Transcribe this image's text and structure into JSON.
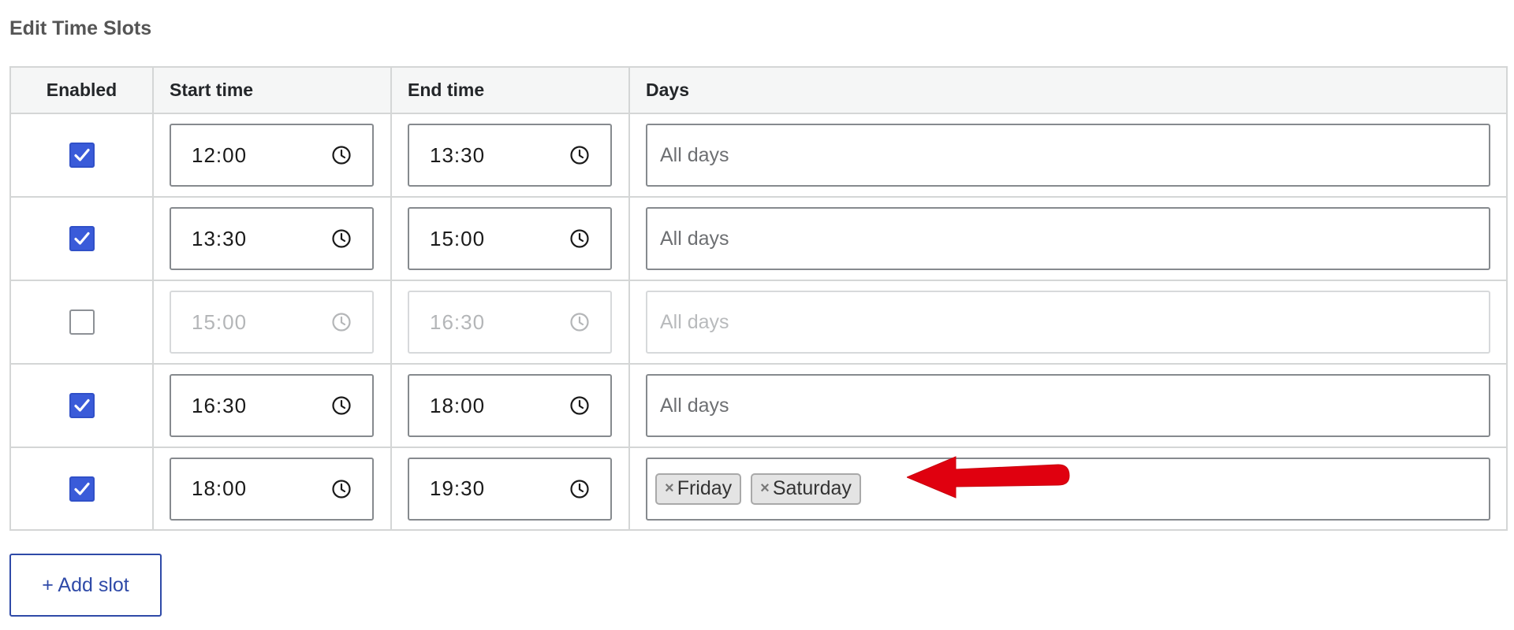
{
  "page": {
    "title": "Edit Time Slots"
  },
  "table": {
    "headers": {
      "enabled": "Enabled",
      "start_time": "Start time",
      "end_time": "End time",
      "days": "Days"
    },
    "rows": [
      {
        "enabled": true,
        "start": "12:00",
        "end": "13:30",
        "days_placeholder": "All days",
        "days_tags": []
      },
      {
        "enabled": true,
        "start": "13:30",
        "end": "15:00",
        "days_placeholder": "All days",
        "days_tags": []
      },
      {
        "enabled": false,
        "start": "15:00",
        "end": "16:30",
        "days_placeholder": "All days",
        "days_tags": []
      },
      {
        "enabled": true,
        "start": "16:30",
        "end": "18:00",
        "days_placeholder": "All days",
        "days_tags": []
      },
      {
        "enabled": true,
        "start": "18:00",
        "end": "19:30",
        "days_placeholder": "",
        "days_tags": [
          "Friday",
          "Saturday"
        ]
      }
    ]
  },
  "actions": {
    "add_slot_label": "+ Add slot"
  },
  "icons": {
    "checkbox": "checkmark-icon",
    "time": "clock-icon",
    "tag_remove": "close-icon",
    "annotation": "arrow-left-icon"
  },
  "colors": {
    "accent": "#3a5bd9",
    "annotation_arrow": "#e0000f",
    "button_text": "#2f4aa8"
  }
}
